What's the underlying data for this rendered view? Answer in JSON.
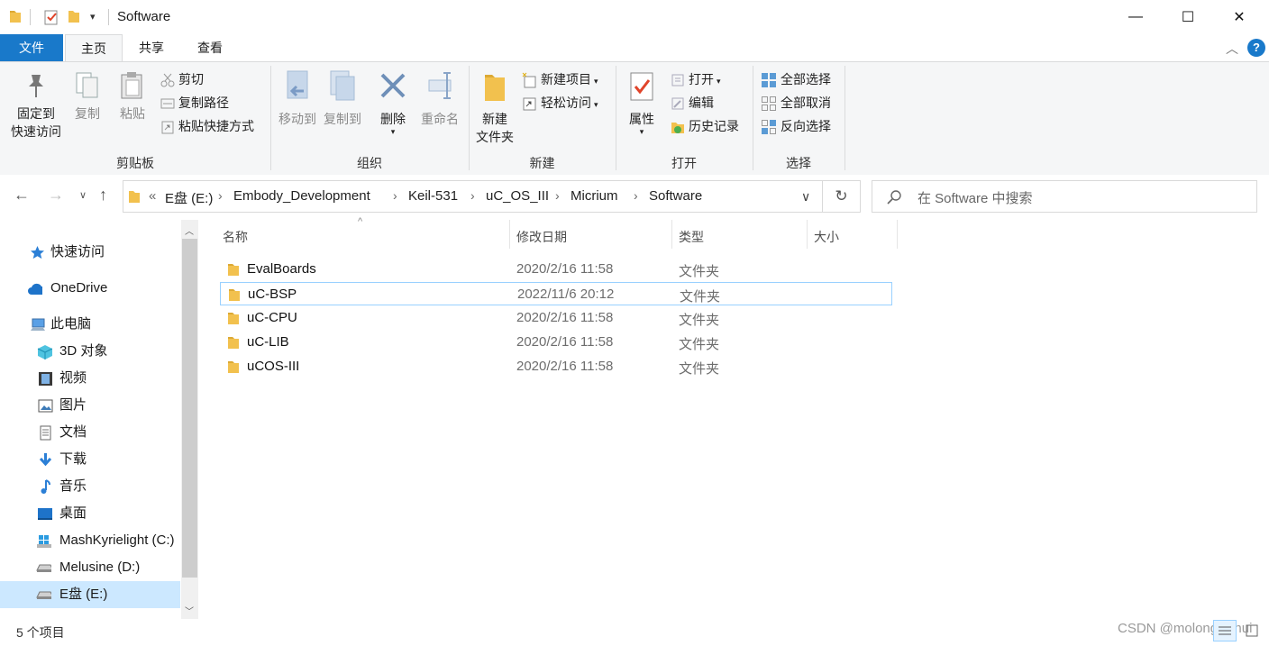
{
  "window": {
    "title": "Software",
    "controls": {
      "minimize": "—",
      "maximize": "☐",
      "close": "✕"
    }
  },
  "tabs": [
    {
      "label": "文件",
      "active": false,
      "accent": "#1979ca"
    },
    {
      "label": "主页",
      "active": true
    },
    {
      "label": "共享",
      "active": false
    },
    {
      "label": "查看",
      "active": false
    }
  ],
  "ribbon": {
    "clipboard": {
      "pin_label_1": "固定到",
      "pin_label_2": "快速访问",
      "copy_label": "复制",
      "paste_label": "粘贴",
      "cut_label": "剪切",
      "copy_path_label": "复制路径",
      "paste_shortcut_label": "粘贴快捷方式",
      "group_label": "剪贴板"
    },
    "organize": {
      "move_to_label": "移动到",
      "copy_to_label": "复制到",
      "delete_label": "删除",
      "rename_label": "重命名",
      "group_label": "组织"
    },
    "new": {
      "new_folder_label_1": "新建",
      "new_folder_label_2": "文件夹",
      "new_item_label": "新建项目",
      "easy_access_label": "轻松访问",
      "group_label": "新建"
    },
    "open": {
      "properties_label": "属性",
      "open_label": "打开",
      "edit_label": "编辑",
      "history_label": "历史记录",
      "group_label": "打开"
    },
    "select": {
      "select_all_label": "全部选择",
      "select_none_label": "全部取消",
      "invert_label": "反向选择",
      "group_label": "选择"
    }
  },
  "address": {
    "overflow": "«",
    "crumbs": [
      "E盘 (E:)",
      "Embody_Development",
      "Keil-531",
      "uC_OS_III",
      "Micrium",
      "Software"
    ],
    "search_placeholder": "在 Software 中搜索"
  },
  "nav": {
    "items": [
      {
        "label": "快速访问",
        "icon": "star-icon"
      },
      {
        "label": "OneDrive",
        "icon": "cloud-icon"
      },
      {
        "label": "此电脑",
        "icon": "computer-icon"
      },
      {
        "label": "3D 对象",
        "icon": "cube-icon"
      },
      {
        "label": "视频",
        "icon": "video-icon"
      },
      {
        "label": "图片",
        "icon": "picture-icon"
      },
      {
        "label": "文档",
        "icon": "document-icon"
      },
      {
        "label": "下载",
        "icon": "download-icon"
      },
      {
        "label": "音乐",
        "icon": "music-icon"
      },
      {
        "label": "桌面",
        "icon": "desktop-icon"
      },
      {
        "label": "MashKyrielight (C:)",
        "icon": "windows-drive-icon"
      },
      {
        "label": "Melusine (D:)",
        "icon": "drive-icon"
      },
      {
        "label": "E盘 (E:)",
        "icon": "drive-icon",
        "selected": true
      }
    ]
  },
  "columns": {
    "name": "名称",
    "date": "修改日期",
    "type": "类型",
    "size": "大小"
  },
  "files": [
    {
      "name": "EvalBoards",
      "date": "2020/2/16 11:58",
      "type": "文件夹"
    },
    {
      "name": "uC-BSP",
      "date": "2022/11/6 20:12",
      "type": "文件夹",
      "focused": true
    },
    {
      "name": "uC-CPU",
      "date": "2020/2/16 11:58",
      "type": "文件夹"
    },
    {
      "name": "uC-LIB",
      "date": "2020/2/16 11:58",
      "type": "文件夹"
    },
    {
      "name": "uCOS-III",
      "date": "2020/2/16 11:58",
      "type": "文件夹"
    }
  ],
  "status": {
    "item_count": "5 个项目"
  },
  "watermark": "CSDN @molongcishui",
  "colors": {
    "accent": "#1979ca",
    "folder": "#f2c14e",
    "selection_border": "#99d1ff"
  }
}
